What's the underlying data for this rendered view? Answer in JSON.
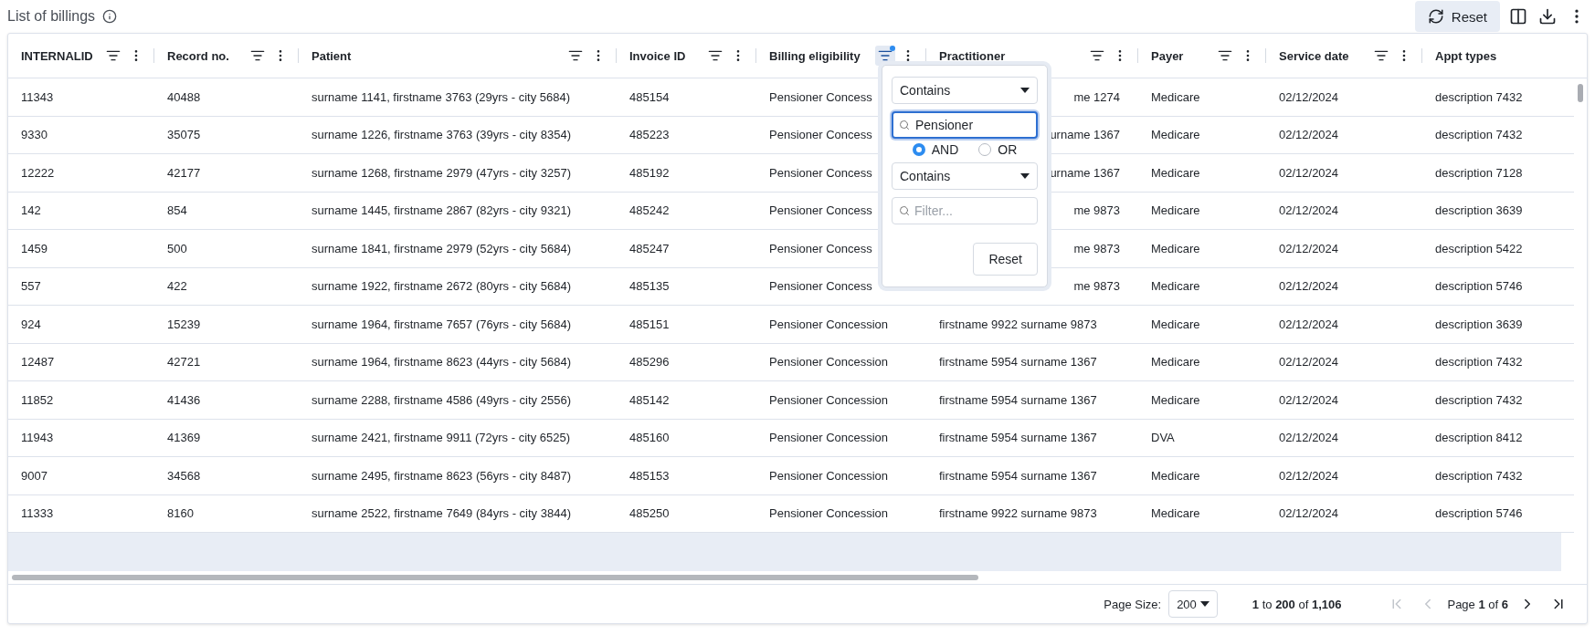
{
  "title": "List of billings",
  "toolbar": {
    "reset_label": "Reset"
  },
  "columns": [
    {
      "label": "INTERNALID",
      "filter_active": false,
      "has_menu": true
    },
    {
      "label": "Record no.",
      "filter_active": false,
      "has_menu": true
    },
    {
      "label": "Patient",
      "filter_active": false,
      "has_menu": true
    },
    {
      "label": "Invoice ID",
      "filter_active": false,
      "has_menu": true
    },
    {
      "label": "Billing eligibility",
      "filter_active": true,
      "has_menu": true
    },
    {
      "label": "Practitioner",
      "filter_active": false,
      "has_menu": true
    },
    {
      "label": "Payer",
      "filter_active": false,
      "has_menu": true
    },
    {
      "label": "Service date",
      "filter_active": false,
      "has_menu": true
    },
    {
      "label": "Appt types",
      "has_menu": false
    }
  ],
  "rows": [
    {
      "behind_popup": true,
      "cells": [
        "11343",
        "40488",
        "surname 1141, firstname 3763 (29yrs - city 5684)",
        "485154",
        "Pensioner Concess",
        "me 1274",
        "Medicare",
        "02/12/2024",
        "description 7432"
      ]
    },
    {
      "behind_popup": true,
      "cells": [
        "9330",
        "35075",
        "surname 1226, firstname 3763 (39yrs - city 8354)",
        "485223",
        "Pensioner Concess",
        "urname 1367",
        "Medicare",
        "02/12/2024",
        "description 7432"
      ]
    },
    {
      "behind_popup": true,
      "cells": [
        "12222",
        "42177",
        "surname 1268, firstname 2979 (47yrs - city 3257)",
        "485192",
        "Pensioner Concess",
        "urname 1367",
        "Medicare",
        "02/12/2024",
        "description 7128"
      ]
    },
    {
      "behind_popup": true,
      "cells": [
        "142",
        "854",
        "surname 1445, firstname 2867 (82yrs - city 9321)",
        "485242",
        "Pensioner Concess",
        "me 9873",
        "Medicare",
        "02/12/2024",
        "description 3639"
      ]
    },
    {
      "behind_popup": true,
      "cells": [
        "1459",
        "500",
        "surname 1841, firstname 2979 (52yrs - city 5684)",
        "485247",
        "Pensioner Concess",
        "me 9873",
        "Medicare",
        "02/12/2024",
        "description 5422"
      ]
    },
    {
      "behind_popup": true,
      "cells": [
        "557",
        "422",
        "surname 1922, firstname 2672 (80yrs - city 5684)",
        "485135",
        "Pensioner Concess",
        "me 9873",
        "Medicare",
        "02/12/2024",
        "description 5746"
      ]
    },
    {
      "behind_popup": false,
      "cells": [
        "924",
        "15239",
        "surname 1964, firstname 7657 (76yrs - city 5684)",
        "485151",
        "Pensioner Concession",
        "firstname 9922 surname 9873",
        "Medicare",
        "02/12/2024",
        "description 3639"
      ]
    },
    {
      "behind_popup": false,
      "cells": [
        "12487",
        "42721",
        "surname 1964, firstname 8623 (44yrs - city 5684)",
        "485296",
        "Pensioner Concession",
        "firstname 5954 surname 1367",
        "Medicare",
        "02/12/2024",
        "description 7432"
      ]
    },
    {
      "behind_popup": false,
      "cells": [
        "11852",
        "41436",
        "surname 2288, firstname 4586 (49yrs - city 2556)",
        "485142",
        "Pensioner Concession",
        "firstname 5954 surname 1367",
        "Medicare",
        "02/12/2024",
        "description 7432"
      ]
    },
    {
      "behind_popup": false,
      "cells": [
        "11943",
        "41369",
        "surname 2421, firstname 9911 (72yrs - city 6525)",
        "485160",
        "Pensioner Concession",
        "firstname 5954 surname 1367",
        "DVA",
        "02/12/2024",
        "description 8412"
      ]
    },
    {
      "behind_popup": false,
      "cells": [
        "9007",
        "34568",
        "surname 2495, firstname 8623 (56yrs - city 8487)",
        "485153",
        "Pensioner Concession",
        "firstname 5954 surname 1367",
        "Medicare",
        "02/12/2024",
        "description 7432"
      ]
    },
    {
      "behind_popup": false,
      "cells": [
        "11333",
        "8160",
        "surname 2522, firstname 7649 (84yrs - city 3844)",
        "485250",
        "Pensioner Concession",
        "firstname 9922 surname 9873",
        "Medicare",
        "02/12/2024",
        "description 5746"
      ]
    }
  ],
  "filter_popup": {
    "condition_1": "Contains",
    "value_1": "Pensioner",
    "operators": [
      {
        "label": "AND",
        "selected": true
      },
      {
        "label": "OR",
        "selected": false
      }
    ],
    "condition_2": "Contains",
    "placeholder_2": "Filter...",
    "reset_label": "Reset"
  },
  "footer": {
    "page_size_label": "Page Size:",
    "page_size": "200",
    "range": "**1** to **200** of **1,106**",
    "page": "Page **1** of **6**",
    "first_disabled": true,
    "prev_disabled": true,
    "next_disabled": false,
    "last_disabled": false
  }
}
